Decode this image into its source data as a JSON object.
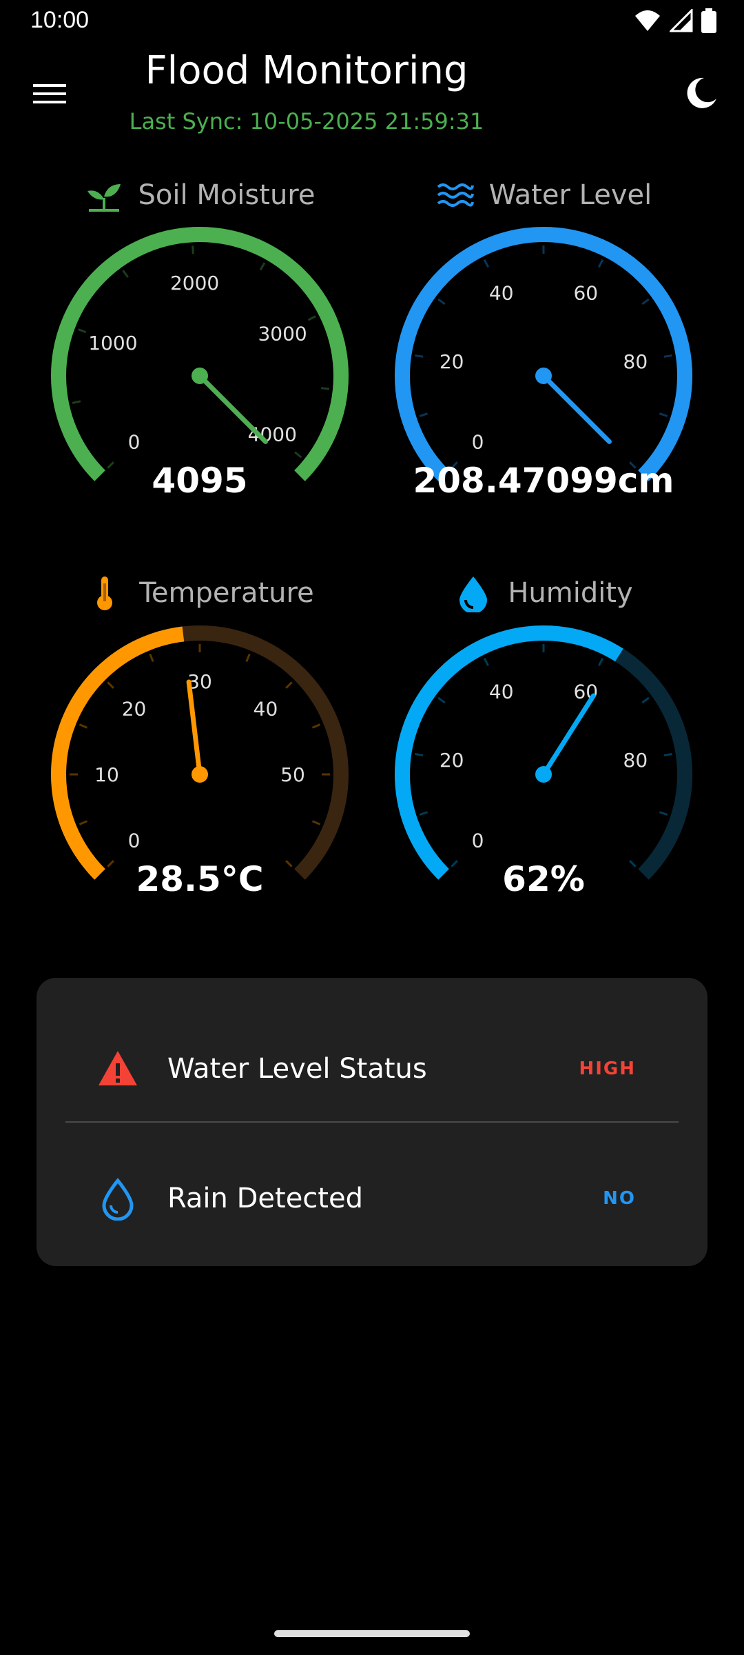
{
  "status_bar": {
    "time": "10:00"
  },
  "header": {
    "title": "Flood Monitoring",
    "last_sync": "Last Sync: 10-05-2025 21:59:31"
  },
  "gauges": [
    {
      "id": "soil-moisture",
      "label": "Soil Moisture",
      "icon": "sprout-icon",
      "color": "#4caf50",
      "track_color": "#16321a",
      "min": 0,
      "max": 4095,
      "value": 4095,
      "ticks": [
        "0",
        "1000",
        "2000",
        "3000",
        "4000"
      ],
      "tick_values": [
        0,
        1000,
        2000,
        3000,
        4000
      ],
      "display_value": "4095"
    },
    {
      "id": "water-level",
      "label": "Water Level",
      "icon": "waves-icon",
      "color": "#2196f3",
      "track_color": "#0c2a45",
      "min": 0,
      "max": 100,
      "value": 100,
      "needle_value": 100,
      "ticks": [
        "0",
        "20",
        "40",
        "60",
        "80"
      ],
      "tick_values": [
        0,
        20,
        40,
        60,
        80
      ],
      "display_value": "208.47099cm"
    },
    {
      "id": "temperature",
      "label": "Temperature",
      "icon": "thermometer-icon",
      "color": "#ff9800",
      "track_color": "#3a2510",
      "min": 0,
      "max": 60,
      "value": 28.5,
      "ticks": [
        "0",
        "10",
        "20",
        "30",
        "40",
        "50"
      ],
      "tick_values": [
        0,
        10,
        20,
        30,
        40,
        50
      ],
      "display_value": "28.5°C"
    },
    {
      "id": "humidity",
      "label": "Humidity",
      "icon": "water-drop-icon",
      "color": "#03a9f4",
      "track_color": "#082838",
      "min": 0,
      "max": 100,
      "value": 62,
      "ticks": [
        "0",
        "20",
        "40",
        "60",
        "80"
      ],
      "tick_values": [
        0,
        20,
        40,
        60,
        80
      ],
      "display_value": "62%"
    }
  ],
  "status_card": {
    "rows": [
      {
        "icon": "warning-icon",
        "icon_color": "#f44336",
        "label": "Water Level Status",
        "value": "HIGH",
        "value_color": "#f44336"
      },
      {
        "icon": "water-drop-outline-icon",
        "icon_color": "#2196f3",
        "label": "Rain Detected",
        "value": "NO",
        "value_color": "#2196f3"
      }
    ]
  }
}
